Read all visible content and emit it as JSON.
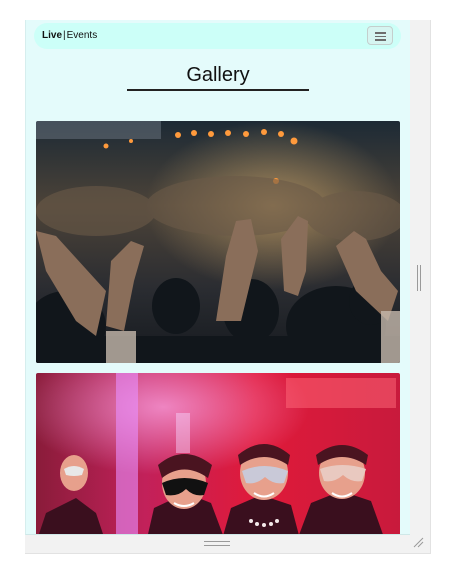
{
  "navbar": {
    "brand_bold": "Live",
    "brand_separator": "|",
    "brand_light": "Events",
    "toggler_icon": "hamburger-menu-icon"
  },
  "page": {
    "title": "Gallery"
  },
  "gallery": {
    "images": [
      {
        "name": "concert-crowd-photo"
      },
      {
        "name": "masquerade-party-photo"
      }
    ]
  },
  "colors": {
    "navbar_bg": "#ccfff8",
    "page_bg": "#e4fbfb"
  }
}
